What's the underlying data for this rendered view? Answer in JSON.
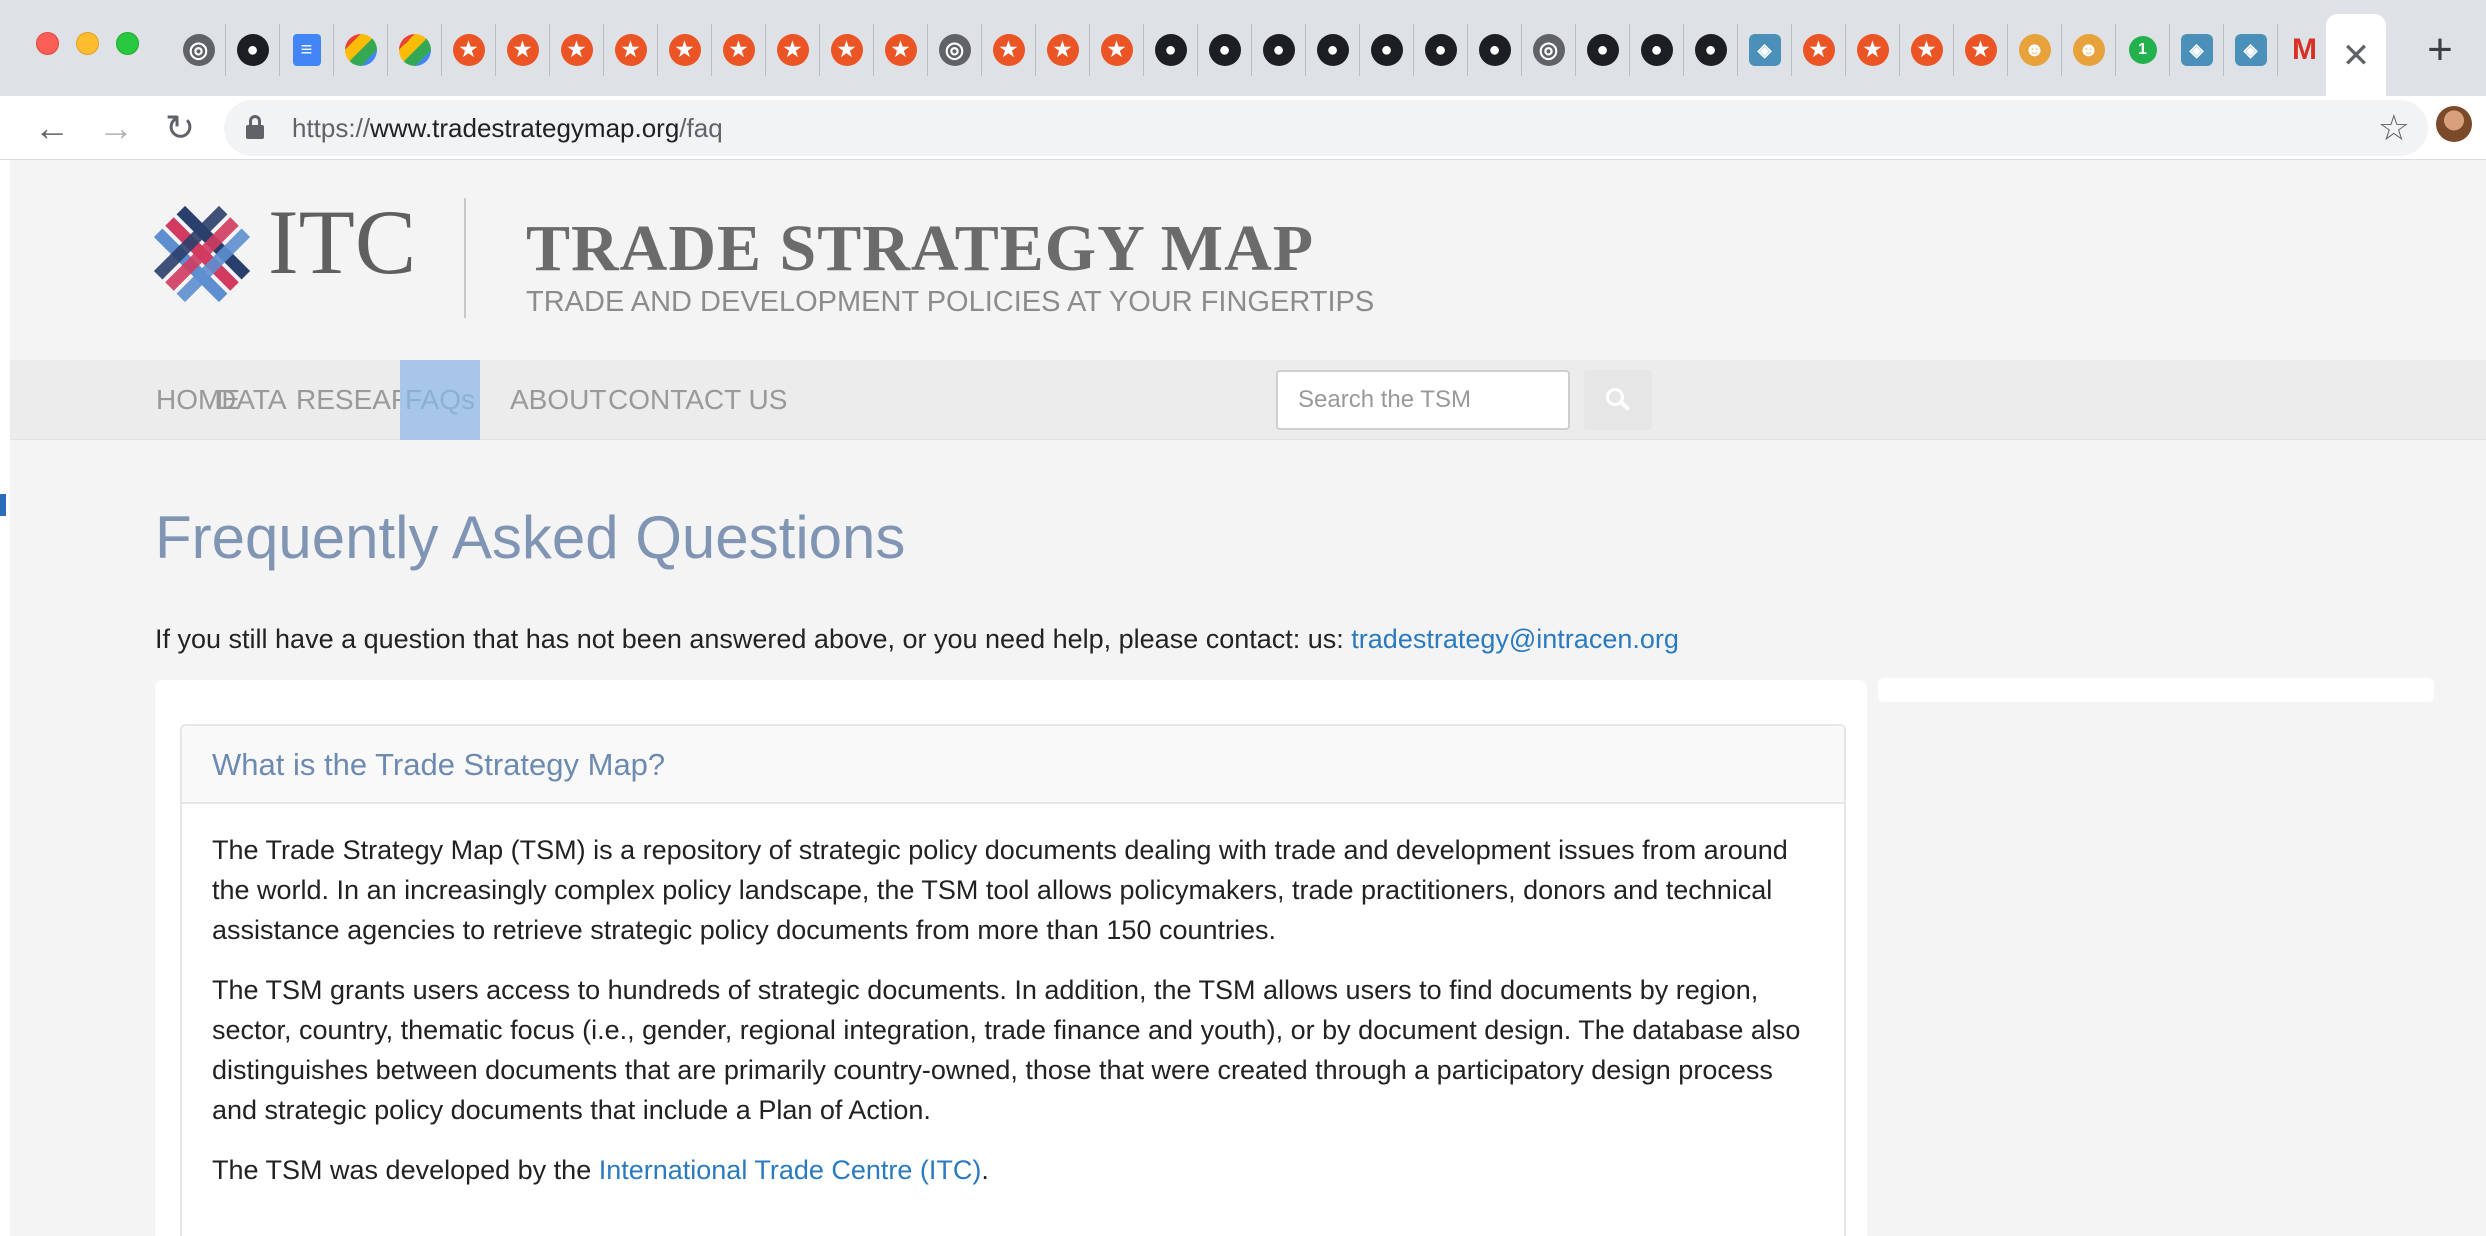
{
  "browser": {
    "tab_icons": [
      "globe-icon",
      "github-icon",
      "docs-icon",
      "pinwheel-icon",
      "pinwheel-icon",
      "auth0-icon",
      "auth0-icon",
      "auth0-icon",
      "auth0-icon",
      "auth0-icon",
      "auth0-icon",
      "auth0-icon",
      "auth0-icon",
      "auth0-icon",
      "globe-icon",
      "auth0-icon",
      "auth0-icon",
      "auth0-icon",
      "github-icon",
      "github-icon",
      "github-icon",
      "github-icon",
      "github-icon",
      "github-icon",
      "github-icon",
      "globe-icon",
      "github-icon",
      "github-icon",
      "github-icon",
      "codesandbox-icon",
      "auth0-icon",
      "auth0-icon",
      "auth0-icon",
      "auth0-icon",
      "firefox-icon",
      "firefox-icon",
      "one-badge-icon",
      "codesandbox-icon",
      "codesandbox-icon",
      "gmail-icon"
    ],
    "active_tab_close": "✕",
    "new_tab": "+",
    "url_scheme": "https://",
    "url_host": "www.tradestrategymap.org",
    "url_path": "/faq"
  },
  "site": {
    "logo_text": "ITC",
    "title": "TRADE STRATEGY MAP",
    "tagline": "TRADE AND DEVELOPMENT POLICIES AT YOUR FINGERTIPS",
    "colors": {
      "accent": "#a8c7e8",
      "heading": "#8094b3",
      "link": "#2a7ac0"
    }
  },
  "nav": {
    "items": [
      {
        "label": "HOME"
      },
      {
        "label": "DATA"
      },
      {
        "label": "RESEARCH"
      },
      {
        "label": "FAQs",
        "active": true
      },
      {
        "label": "ABOUT"
      },
      {
        "label": "CONTACT US"
      }
    ],
    "search_placeholder": "Search the TSM"
  },
  "main": {
    "heading": "Frequently Asked Questions",
    "intro_text": "If you still have a question that has not been answered above, or you need help, please contact: us: ",
    "intro_email": "tradestrategy@intracen.org",
    "faq": {
      "question": "What is the Trade Strategy Map?",
      "p1": "The Trade Strategy Map (TSM) is a repository of strategic policy documents dealing with trade and development issues from around the world. In an increasingly complex policy landscape, the TSM tool allows policymakers, trade practitioners, donors and technical assistance agencies to retrieve strategic policy documents from more than 150 countries.",
      "p2": "The TSM grants users access to hundreds of strategic documents. In addition, the TSM allows users to find documents by region, sector, country, thematic focus (i.e., gender, regional integration, trade finance and youth), or by document design. The database also distinguishes between documents that are primarily country-owned, those that were created through a participatory design process and strategic policy documents that include a Plan of Action.",
      "p3_prefix": "The TSM was developed by the ",
      "p3_link": "International Trade Centre (ITC)",
      "p3_suffix": "."
    }
  }
}
